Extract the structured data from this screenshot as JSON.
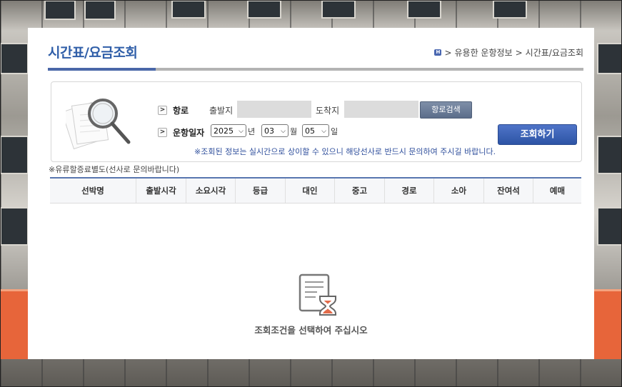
{
  "page": {
    "title": "시간표/요금조회",
    "breadcrumb": {
      "home_icon": "home-icon",
      "items": [
        "유용한 운항정보",
        "시간표/요금조회"
      ]
    }
  },
  "search": {
    "route_label": "항로",
    "departure_label": "출발지",
    "departure_value": "",
    "arrival_label": "도착지",
    "arrival_value": "",
    "route_search_button": "항로검색",
    "date_label": "운항일자",
    "year": "2025",
    "year_unit": "년",
    "month": "03",
    "month_unit": "월",
    "day": "05",
    "day_unit": "일",
    "submit_button": "조회하기",
    "notice": "※조회된 정보는 실시간으로 상이할 수 있으니 해당선사로 반드시 문의하여 주시길 바랍니다."
  },
  "fee_note": "※유류할증료별도(선사로 문의바랍니다)",
  "table": {
    "columns": [
      "선박명",
      "출발시각",
      "소요시각",
      "등급",
      "대인",
      "중고",
      "경로",
      "소아",
      "잔여석",
      "예매"
    ],
    "rows": []
  },
  "empty_state": {
    "icon": "hourglass-document-icon",
    "message": "조회조건을 선택하여 주십시오"
  },
  "colors": {
    "title": "#2f5ea8",
    "accent_bar": "#4a67a8",
    "button": "#2d54a5",
    "notice": "#2f4f9c"
  }
}
